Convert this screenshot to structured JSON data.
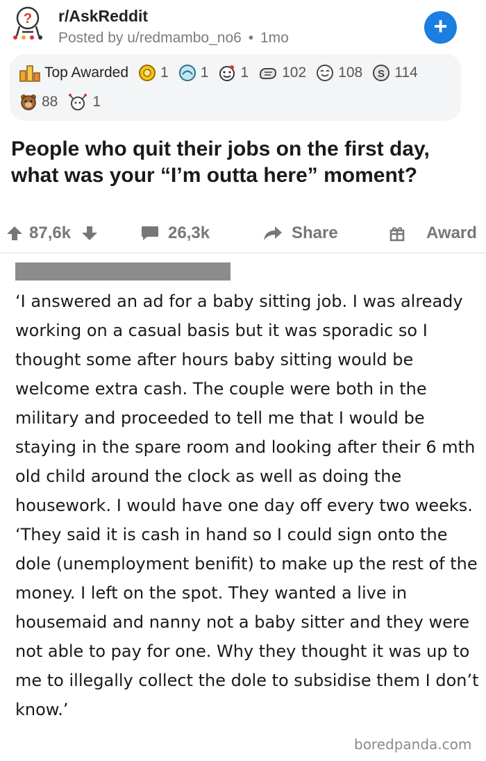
{
  "post": {
    "subreddit": "r/AskReddit",
    "posted_by": "Posted by u/redmambo_no6",
    "separator": "•",
    "age": "1mo",
    "title": "People who quit their jobs on the first day, what was your “I’m outta here” moment?"
  },
  "awards": {
    "label": "Top Awarded",
    "items": [
      {
        "icon": "gold-award-icon",
        "count": "1"
      },
      {
        "icon": "platinum-award-icon",
        "count": "1"
      },
      {
        "icon": "face-award-icon",
        "count": "1"
      },
      {
        "icon": "hand-award-icon",
        "count": "102"
      },
      {
        "icon": "wholesome-award-icon",
        "count": "108"
      },
      {
        "icon": "silver-award-icon",
        "count": "114"
      },
      {
        "icon": "bear-award-icon",
        "count": "88"
      },
      {
        "icon": "ladybug-award-icon",
        "count": "1"
      }
    ]
  },
  "actions": {
    "upvotes": "87,6k",
    "comments": "26,3k",
    "share": "Share",
    "award": "Award"
  },
  "comment": {
    "paragraph_1": "‘I answered an ad for a baby sitting job. I was already working on a casual basis but it was sporadic so I thought some after hours baby sitting would be welcome extra cash. The couple were both in the military and proceeded to tell me that I would be staying in the spare room and looking after their 6 mth old child around the clock as well as doing the housework. I would have one day off every two weeks.",
    "paragraph_2": "‘They said it is cash in hand so I could sign onto the dole (unemployment benifit) to make up the rest of the money. I left on the spot. They wanted a live in housemaid and nanny not a baby sitter and they were not able to pay for one. Why they thought it was up to me to illegally collect the dole to subsidise them I don’t know.’"
  },
  "watermark": "boredpanda.com",
  "colors": {
    "accent_blue": "#1a7fe0",
    "award_panel": "#f4f5f6",
    "muted_text": "#7c7c7c",
    "redaction": "#8c8c8c"
  }
}
